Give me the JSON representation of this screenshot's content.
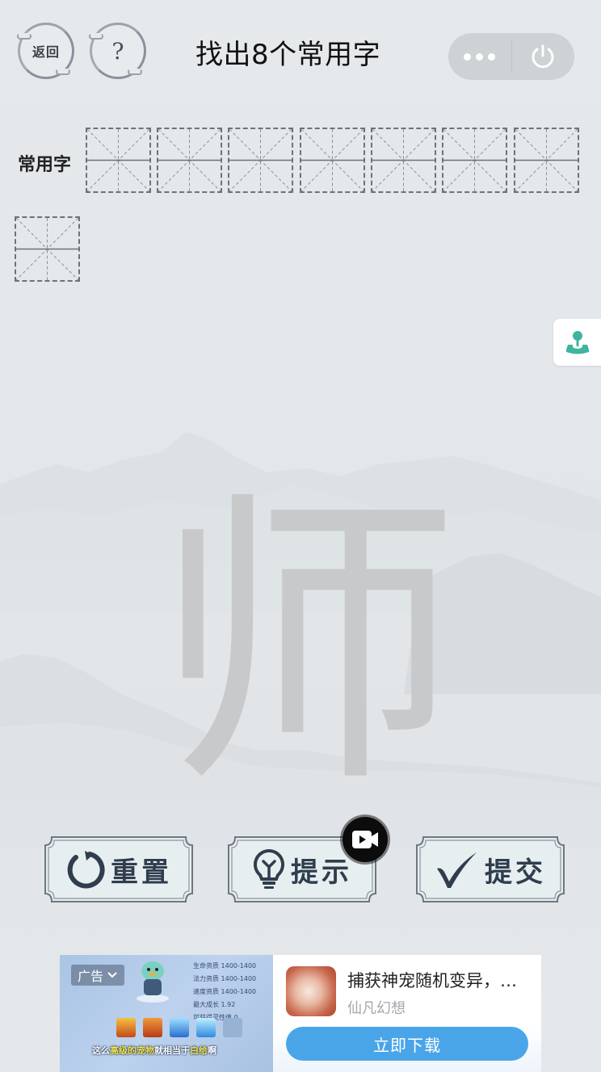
{
  "header": {
    "back_label": "返回",
    "help_label": "?",
    "title": "找出8个常用字",
    "more_icon": "more-dots-icon",
    "close_icon": "power-icon"
  },
  "answer": {
    "label": "常用字",
    "slot_count": 8,
    "slots": [
      "",
      "",
      "",
      "",
      "",
      "",
      "",
      ""
    ]
  },
  "side_float": {
    "icon": "joystick-icon",
    "color": "#3fb59f"
  },
  "puzzle": {
    "character": "师"
  },
  "actions": {
    "reset": {
      "label": "重置",
      "icon": "refresh-icon"
    },
    "hint": {
      "label": "提示",
      "icon": "lightbulb-icon",
      "badge_icon": "video-icon"
    },
    "submit": {
      "label": "提交",
      "icon": "check-icon"
    }
  },
  "ad": {
    "tag": "广告",
    "stats": [
      "生命资质 1400-1400",
      "法力资质 1400-1400",
      "速度资质 1400-1400",
      "最大成长 1.92",
      "可获得灵性值 0"
    ],
    "caption_prefix": "这么",
    "caption_hl1": "高级的宠物",
    "caption_mid": "就相当于",
    "caption_hl2": "白给",
    "caption_suffix": "啊",
    "title": "捕获神宠随机变异，…",
    "app_name": "仙凡幻想",
    "cta": "立即下载",
    "cta_color": "#4aa5e8"
  }
}
